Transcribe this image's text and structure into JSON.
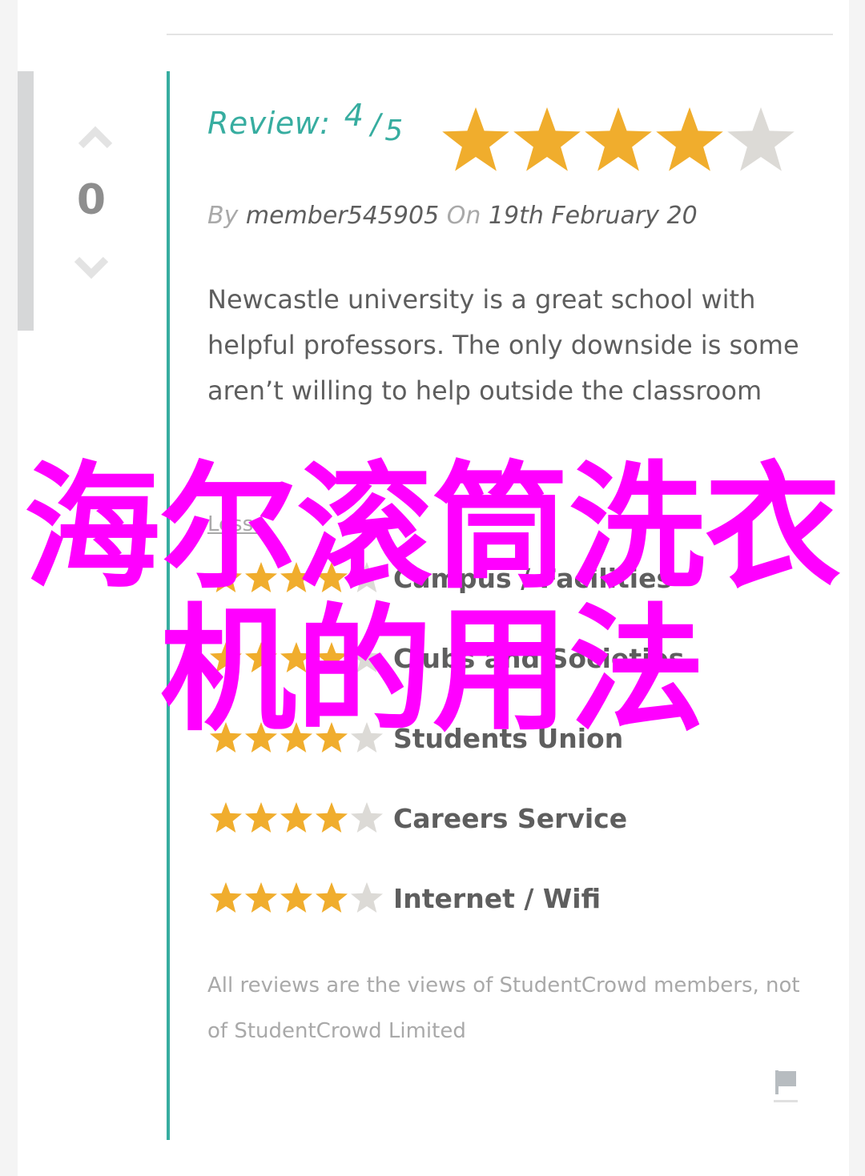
{
  "colors": {
    "accent_teal": "#37ada0",
    "star_filled": "#f0ad2d",
    "star_empty": "#dcdad6",
    "overlay_magenta": "#ff00ff",
    "text_primary": "#5e5e5e",
    "text_muted": "#a9a9a9"
  },
  "vote": {
    "up_icon": "chevron-up-icon",
    "count": "0",
    "down_icon": "chevron-down-icon"
  },
  "review": {
    "label": "Review:",
    "score": "4",
    "slash": "/",
    "max": "5",
    "rating": 4,
    "rating_max": 5,
    "by_label": "By",
    "author": "member545905",
    "on_label": "On",
    "date": "19th February 20",
    "body": "Newcastle university is a great school with helpful professors. The only downside is some aren’t willing to help outside the classroom",
    "less_link": "Less..."
  },
  "categories": [
    {
      "name": "Campus / Facilities",
      "rating": 4
    },
    {
      "name": "Clubs and Societies",
      "rating": 4
    },
    {
      "name": "Students Union",
      "rating": 4
    },
    {
      "name": "Careers Service",
      "rating": 4
    },
    {
      "name": "Internet / Wifi",
      "rating": 4
    }
  ],
  "disclaimer": "All reviews are the views of StudentCrowd members, not of StudentCrowd Limited",
  "flag_icon": "flag-icon",
  "overlay": {
    "line1": "海尔滚筒洗衣",
    "line2": "机的用法"
  }
}
